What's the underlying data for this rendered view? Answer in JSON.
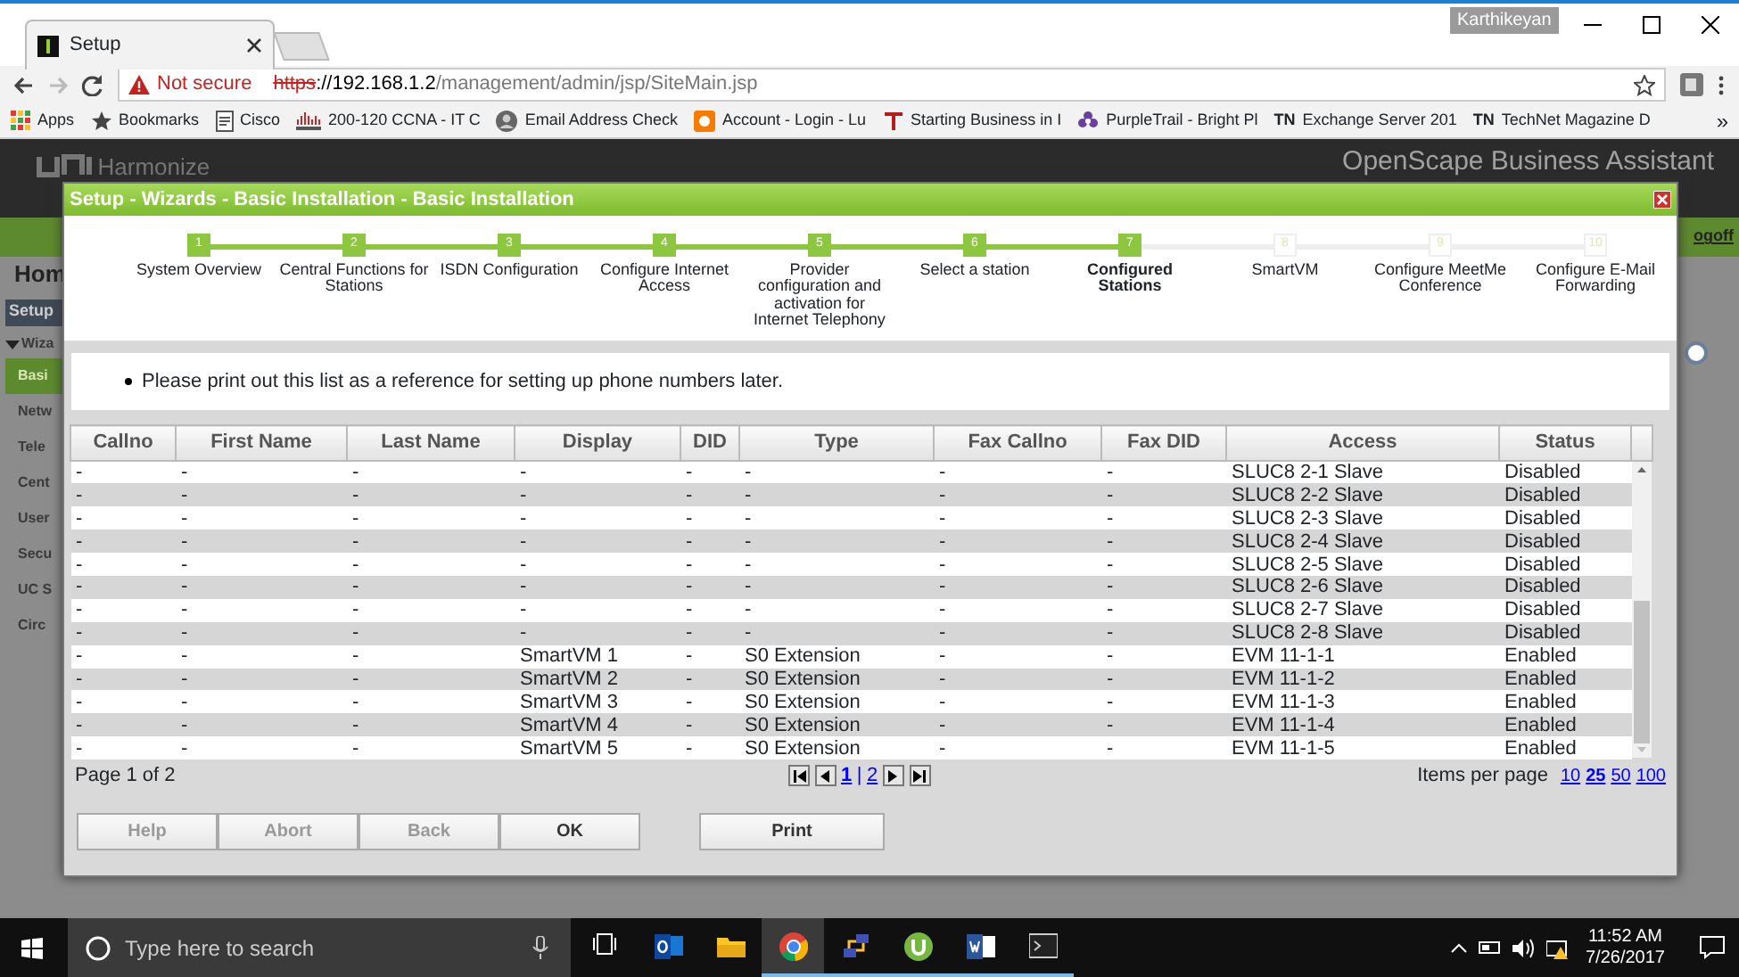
{
  "browser": {
    "tab_title": "Setup",
    "user": "Karthikeyan",
    "security": "Not secure",
    "url_scheme": "https",
    "url_host": "://192.168.1.2",
    "url_path": "/management/admin/jsp/SiteMain.jsp",
    "bookmarks": [
      {
        "label": "Apps",
        "kind": "apps"
      },
      {
        "label": "Bookmarks",
        "kind": "star"
      },
      {
        "label": "Cisco",
        "kind": "page"
      },
      {
        "label": "200-120 CCNA - IT C",
        "kind": "cisco"
      },
      {
        "label": "Email Address Check",
        "kind": "person"
      },
      {
        "label": "Account - Login - Lu",
        "kind": "orange"
      },
      {
        "label": "Starting Business in I",
        "kind": "tee"
      },
      {
        "label": "PurpleTrail - Bright Pl",
        "kind": "flower"
      },
      {
        "label": "Exchange Server 201",
        "kind": "text",
        "prefix": "TN"
      },
      {
        "label": "TechNet Magazine D",
        "kind": "text",
        "prefix": "TN"
      }
    ],
    "overflow": "»"
  },
  "app": {
    "brand": "Harmonize",
    "product": "OpenScape Business Assistant",
    "logoff": "ogoff",
    "home": "Hom",
    "sidebar_title": "Setup",
    "sidebar": [
      {
        "label": "Wiza",
        "kind": "group",
        "selected": false
      },
      {
        "label": "Basi",
        "kind": "item",
        "selected": true
      },
      {
        "label": "Netw",
        "kind": "item",
        "selected": false
      },
      {
        "label": "Tele",
        "kind": "item",
        "selected": false
      },
      {
        "label": "Cent",
        "kind": "item",
        "selected": false
      },
      {
        "label": "User",
        "kind": "item",
        "selected": false
      },
      {
        "label": "Secu",
        "kind": "item",
        "selected": false
      },
      {
        "label": "UC S",
        "kind": "item",
        "selected": false
      },
      {
        "label": "Circ",
        "kind": "item",
        "selected": false
      }
    ]
  },
  "dialog": {
    "title": "Setup - Wizards - Basic Installation - Basic Installation",
    "steps": [
      {
        "number": "1",
        "label": "System Overview",
        "completed": true,
        "selected": false
      },
      {
        "number": "2",
        "label": "Central Functions for Stations",
        "completed": true,
        "selected": false
      },
      {
        "number": "3",
        "label": "ISDN Configuration",
        "completed": true,
        "selected": false
      },
      {
        "number": "4",
        "label": "Configure Internet Access",
        "completed": true,
        "selected": false
      },
      {
        "number": "5",
        "label": "Provider configuration and activation for Internet Telephony",
        "completed": true,
        "selected": false
      },
      {
        "number": "6",
        "label": "Select a station",
        "completed": true,
        "selected": false
      },
      {
        "number": "7",
        "label": "Configured Stations",
        "completed": true,
        "selected": true
      },
      {
        "number": "8",
        "label": "SmartVM",
        "completed": false,
        "selected": false
      },
      {
        "number": "9",
        "label": "Configure MeetMe Conference",
        "completed": false,
        "selected": false
      },
      {
        "number": "10",
        "label": "Configure E-Mail Forwarding",
        "completed": false,
        "selected": false
      }
    ],
    "notes": [
      "Please print out this list as a reference for setting up phone numbers later."
    ],
    "table": {
      "columns": [
        "Callno",
        "First Name",
        "Last Name",
        "Display",
        "DID",
        "Type",
        "Fax Callno",
        "Fax DID",
        "Access",
        "Status"
      ],
      "rows": [
        [
          "-",
          "-",
          "-",
          "-",
          "-",
          "-",
          "-",
          "-",
          "SLUC8 2-1 Slave",
          "Disabled"
        ],
        [
          "-",
          "-",
          "-",
          "-",
          "-",
          "-",
          "-",
          "-",
          "SLUC8 2-2 Slave",
          "Disabled"
        ],
        [
          "-",
          "-",
          "-",
          "-",
          "-",
          "-",
          "-",
          "-",
          "SLUC8 2-3 Slave",
          "Disabled"
        ],
        [
          "-",
          "-",
          "-",
          "-",
          "-",
          "-",
          "-",
          "-",
          "SLUC8 2-4 Slave",
          "Disabled"
        ],
        [
          "-",
          "-",
          "-",
          "-",
          "-",
          "-",
          "-",
          "-",
          "SLUC8 2-5 Slave",
          "Disabled"
        ],
        [
          "-",
          "-",
          "-",
          "-",
          "-",
          "-",
          "-",
          "-",
          "SLUC8 2-6 Slave",
          "Disabled"
        ],
        [
          "-",
          "-",
          "-",
          "-",
          "-",
          "-",
          "-",
          "-",
          "SLUC8 2-7 Slave",
          "Disabled"
        ],
        [
          "-",
          "-",
          "-",
          "-",
          "-",
          "-",
          "-",
          "-",
          "SLUC8 2-8 Slave",
          "Disabled"
        ],
        [
          "-",
          "-",
          "-",
          "SmartVM 1",
          "-",
          "S0 Extension",
          "-",
          "-",
          "EVM 11-1-1",
          "Enabled"
        ],
        [
          "-",
          "-",
          "-",
          "SmartVM 2",
          "-",
          "S0 Extension",
          "-",
          "-",
          "EVM 11-1-2",
          "Enabled"
        ],
        [
          "-",
          "-",
          "-",
          "SmartVM 3",
          "-",
          "S0 Extension",
          "-",
          "-",
          "EVM 11-1-3",
          "Enabled"
        ],
        [
          "-",
          "-",
          "-",
          "SmartVM 4",
          "-",
          "S0 Extension",
          "-",
          "-",
          "EVM 11-1-4",
          "Enabled"
        ],
        [
          "-",
          "-",
          "-",
          "SmartVM 5",
          "-",
          "S0 Extension",
          "-",
          "-",
          "EVM 11-1-5",
          "Enabled"
        ]
      ]
    },
    "pager": {
      "summary": "Page 1 of 2",
      "pages": [
        {
          "label": "1",
          "selected": true
        },
        {
          "label": "2",
          "selected": false
        }
      ],
      "separator": "|",
      "per_page_label": "Items per page",
      "per_page": [
        {
          "label": "10",
          "selected": false
        },
        {
          "label": "25",
          "selected": true
        },
        {
          "label": "50",
          "selected": false
        },
        {
          "label": "100",
          "selected": false
        }
      ]
    },
    "buttons": [
      {
        "label": "Help",
        "disabled": true
      },
      {
        "label": "Abort",
        "disabled": true
      },
      {
        "label": "Back",
        "disabled": true
      },
      {
        "label": "OK",
        "disabled": false
      },
      {
        "label": "Print",
        "disabled": false
      }
    ]
  },
  "taskbar": {
    "search_placeholder": "Type here to search",
    "apps": [
      {
        "kind": "taskview",
        "running": false,
        "selected": false
      },
      {
        "kind": "outlook",
        "running": false,
        "selected": false
      },
      {
        "kind": "explorer",
        "running": false,
        "selected": false
      },
      {
        "kind": "chrome",
        "running": true,
        "selected": true
      },
      {
        "kind": "network",
        "running": true,
        "selected": false
      },
      {
        "kind": "torrent",
        "running": true,
        "selected": false
      },
      {
        "kind": "word",
        "running": true,
        "selected": false
      },
      {
        "kind": "console",
        "running": true,
        "selected": false
      }
    ],
    "time": "11:52 AM",
    "date": "7/26/2017"
  }
}
